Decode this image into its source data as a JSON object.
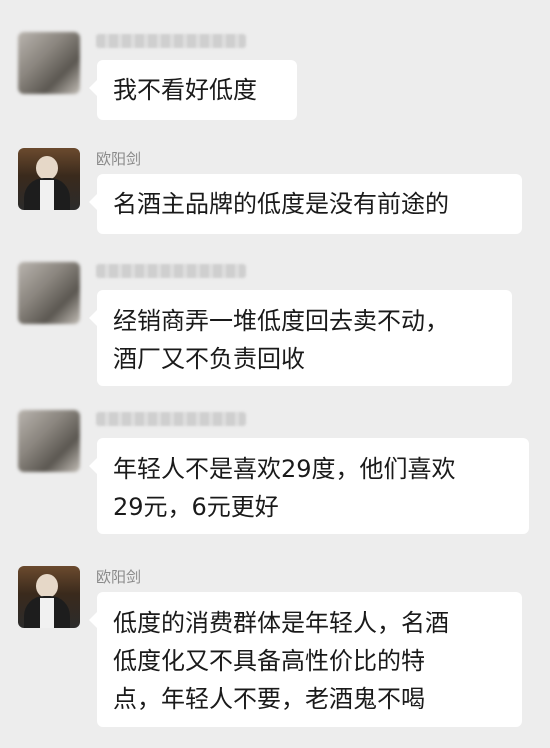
{
  "messages": [
    {
      "sender": "",
      "lines": [
        "我不看好低度"
      ]
    },
    {
      "sender": "欧阳剑",
      "lines": [
        "名酒主品牌的低度是没有前途的"
      ]
    },
    {
      "sender": "",
      "lines": [
        "经销商弄一堆低度回去卖不动，",
        "酒厂又不负责回收"
      ]
    },
    {
      "sender": "",
      "lines": [
        "年轻人不是喜欢29度，他们喜欢",
        "29元，6元更好"
      ]
    },
    {
      "sender": "欧阳剑",
      "lines": [
        "低度的消费群体是年轻人，名酒",
        "低度化又不具备高性价比的特",
        "点，年轻人不要，老酒鬼不喝"
      ]
    }
  ]
}
